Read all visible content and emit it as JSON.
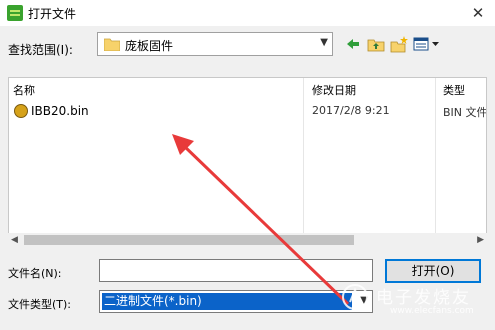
{
  "window": {
    "title": "打开文件",
    "close_glyph": "✕"
  },
  "look_in": {
    "label": "查找范围(I):",
    "value": "庞板固件"
  },
  "columns": {
    "name": "名称",
    "modified": "修改日期",
    "type": "类型"
  },
  "files": [
    {
      "name": "IBB20.bin",
      "modified": "2017/2/8 9:21",
      "type": "BIN 文件"
    }
  ],
  "file_name": {
    "label": "文件名(N):",
    "value": ""
  },
  "file_type": {
    "label": "文件类型(T):",
    "value": "二进制文件(*.bin)"
  },
  "buttons": {
    "open": "打开(O)"
  },
  "watermark": {
    "text": "电子发烧友",
    "sub": "www.elecfans.com"
  },
  "colors": {
    "arrow": "#e83a3a",
    "selection": "#0b63c9",
    "accent": "#0078d7"
  },
  "icons": [
    "app-icon",
    "folder-icon",
    "back-icon",
    "up-folder-icon",
    "new-folder-icon",
    "view-menu-icon",
    "bin-file-icon",
    "close-icon"
  ]
}
